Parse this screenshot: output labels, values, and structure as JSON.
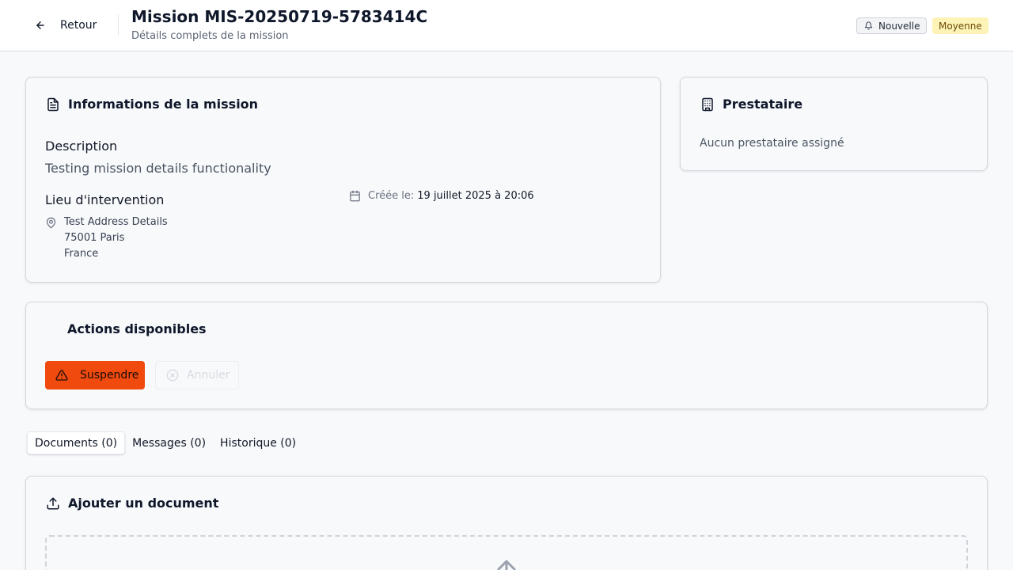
{
  "header": {
    "back_label": "Retour",
    "title": "Mission MIS-20250719-5783414C",
    "subtitle": "Détails complets de la mission",
    "status_badge": "Nouvelle",
    "priority_badge": "Moyenne"
  },
  "mission_info": {
    "title": "Informations de la mission",
    "description_label": "Description",
    "description": "Testing mission details functionality",
    "location_label": "Lieu d'intervention",
    "address_line1": "Test Address Details",
    "address_line2": "75001 Paris",
    "address_line3": "France",
    "created_label": "Créée le:",
    "created_value": "19 juillet 2025 à 20:06"
  },
  "provider": {
    "title": "Prestataire",
    "empty_text": "Aucun prestataire assigné"
  },
  "actions": {
    "title": "Actions disponibles",
    "suspend_label": "Suspendre",
    "cancel_label": "Annuler"
  },
  "tabs": [
    {
      "label": "Documents (0)",
      "active": true
    },
    {
      "label": "Messages (0)",
      "active": false
    },
    {
      "label": "Historique (0)",
      "active": false
    }
  ],
  "upload": {
    "title": "Ajouter un document"
  },
  "colors": {
    "suspend": "#f04a0f",
    "priority_bg": "#fdf3b6"
  },
  "icons": [
    "arrow-left-icon",
    "bell-icon",
    "file-text-icon",
    "building-icon",
    "map-pin-icon",
    "calendar-icon",
    "alert-triangle-icon",
    "circle-x-icon",
    "upload-icon"
  ]
}
